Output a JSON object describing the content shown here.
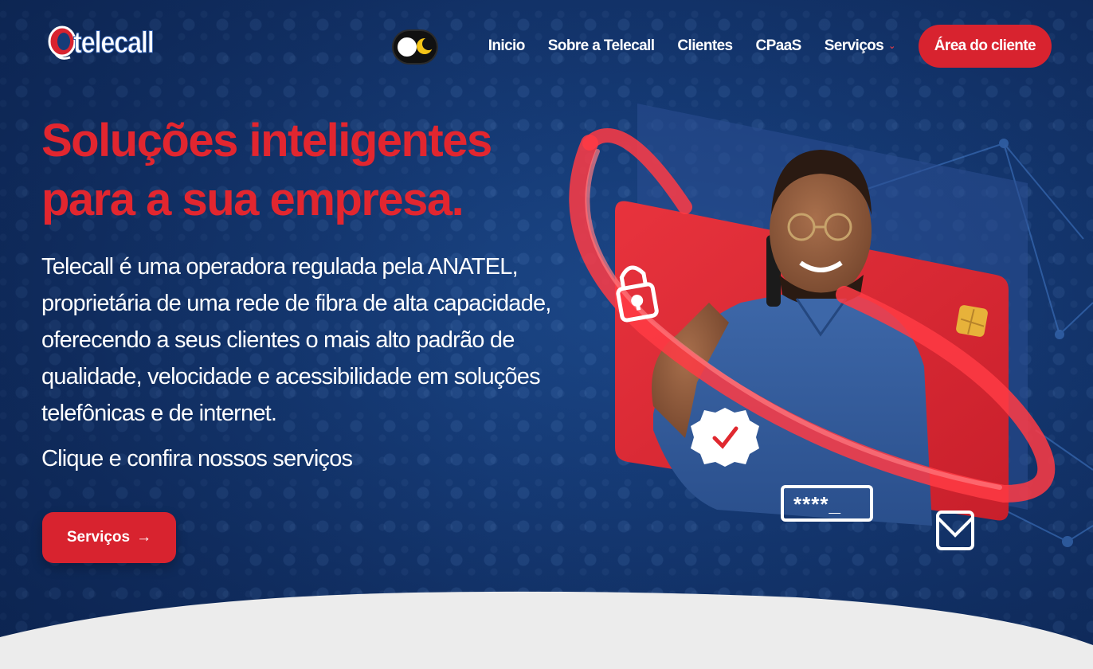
{
  "header": {
    "logo_text": "telecall",
    "nav": {
      "items": [
        {
          "label": "Inicio"
        },
        {
          "label": "Sobre a Telecall"
        },
        {
          "label": "Clientes"
        },
        {
          "label": "CPaaS"
        },
        {
          "label": "Serviços"
        }
      ],
      "cta_label": "Área do cliente"
    }
  },
  "hero": {
    "title": "Soluções inteligentes para a sua empresa.",
    "description": "Telecall é uma operadora regulada pela ANATEL, proprietária de uma rede de fibra de alta capacidade, oferecendo a seus clientes o mais alto padrão de qualidade, velocidade e acessibilidade em soluções telefônicas e de internet.",
    "subtitle": "Clique e confira nossos serviços",
    "button_label": "Serviços",
    "button_arrow": "→",
    "password_field_text": "****_"
  },
  "colors": {
    "brand_red": "#d8232f",
    "background_blue": "#163c78",
    "text_white": "#ffffff"
  },
  "icons": [
    "light-dark-toggle-icon",
    "chevron-down-icon",
    "arrow-right-icon",
    "lock-icon",
    "verified-badge-icon",
    "envelope-icon",
    "card-chip-icon"
  ]
}
